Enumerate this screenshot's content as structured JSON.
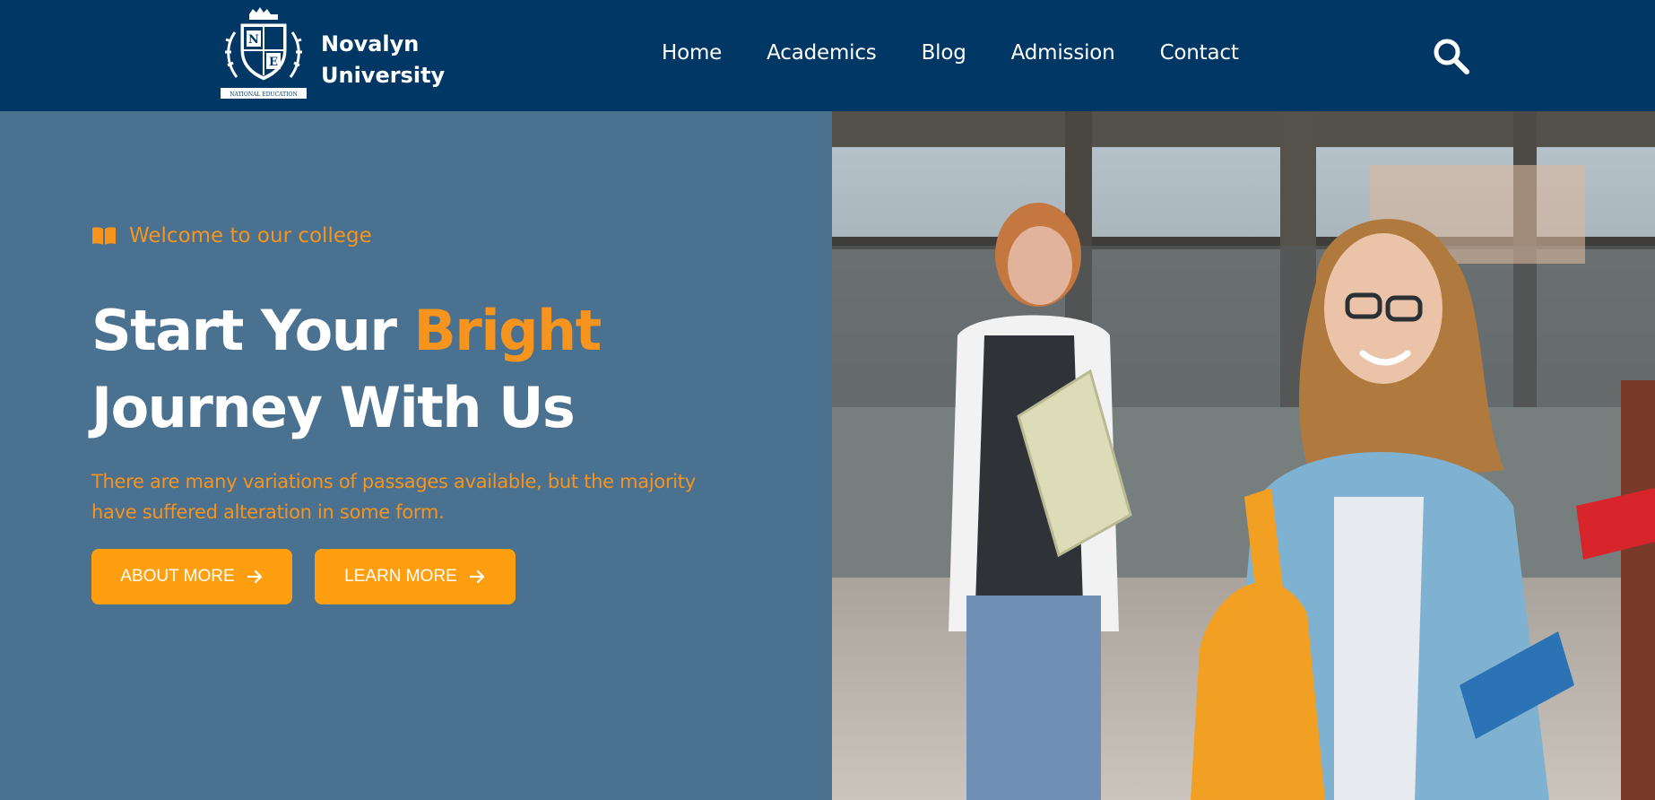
{
  "brand": {
    "name_line1": "Novalyn",
    "name_line2": "University",
    "crest_letters": [
      "N",
      "E"
    ],
    "crest_banner": "NATIONAL EDUCATION"
  },
  "nav": {
    "items": [
      {
        "label": "Home"
      },
      {
        "label": "Academics"
      },
      {
        "label": "Blog"
      },
      {
        "label": "Admission"
      },
      {
        "label": "Contact"
      }
    ],
    "search_icon": "search-icon"
  },
  "hero": {
    "eyebrow": "Welcome to our college",
    "title_part1": "Start Your ",
    "title_accent": "Bright",
    "title_part2": "Journey With Us",
    "description": "There are many variations of passages available, but the majority have suffered alteration in some form.",
    "buttons": [
      {
        "label": "ABOUT MORE",
        "icon": "arrow-right-icon"
      },
      {
        "label": "LEARN MORE",
        "icon": "arrow-right-icon"
      }
    ]
  },
  "colors": {
    "header_bg": "#003764",
    "hero_bg": "#4a7190",
    "accent": "#f7941d",
    "button_bg": "#ff9f0f"
  }
}
